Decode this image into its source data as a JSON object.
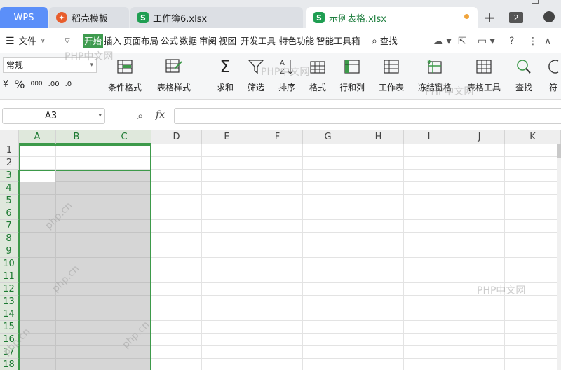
{
  "tabs": {
    "wps": "WPS",
    "items": [
      {
        "label": "稻壳模板",
        "icon": "wps-docer-icon",
        "color": "#e85d2c"
      },
      {
        "label": "工作簿6.xlsx",
        "icon": "spreadsheet-icon",
        "color": "#1f9e52"
      },
      {
        "label": "示例表格.xlsx",
        "icon": "spreadsheet-icon",
        "color": "#1f9e52"
      }
    ],
    "new_tab": "+",
    "window_count": "2"
  },
  "menu": {
    "file": "文件",
    "items": [
      "开始",
      "插入",
      "页面布局",
      "公式",
      "数据",
      "审阅",
      "视图",
      "开发工具",
      "特色功能",
      "智能工具箱"
    ],
    "active": "开始",
    "search": "查找",
    "help": "?"
  },
  "ribbon": {
    "number_format": "常规",
    "format_buttons": [
      "¥",
      "%",
      "000",
      ".00",
      ".0"
    ],
    "groups": [
      "条件格式",
      "表格样式",
      "求和",
      "筛选",
      "排序",
      "格式",
      "行和列",
      "工作表",
      "冻结窗格",
      "表格工具",
      "查找",
      "符"
    ]
  },
  "formula_bar": {
    "cell_ref": "A3",
    "fx": "fx",
    "value": ""
  },
  "sheet": {
    "columns": [
      "A",
      "B",
      "C",
      "D",
      "E",
      "F",
      "G",
      "H",
      "I",
      "J",
      "K"
    ],
    "rows": [
      "1",
      "2",
      "3",
      "4",
      "5",
      "6",
      "7",
      "8",
      "9",
      "10",
      "11",
      "12",
      "13",
      "14",
      "15",
      "16",
      "17",
      "18"
    ],
    "selected_range": "A3:C18",
    "active_cell": "A3"
  },
  "watermarks": [
    "PHP中文网",
    "php.cn"
  ],
  "colors": {
    "accent": "#3d9a4a",
    "wps_tab": "#5b8ff9",
    "selection_fill": "#d6d6d6"
  }
}
